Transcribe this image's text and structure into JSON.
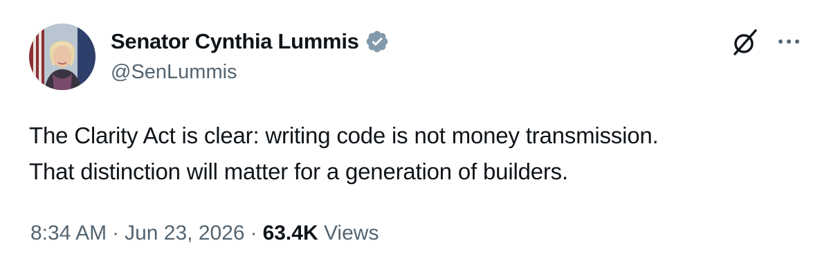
{
  "author": {
    "display_name": "Senator Cynthia Lummis",
    "handle": "@SenLummis",
    "verified_badge": "verified-badge-icon",
    "verified_color": "#829aab"
  },
  "header_actions": {
    "grok": "grok-icon",
    "more": "more-icon"
  },
  "tweet": {
    "lines": [
      "The Clarity Act is clear: writing code is not money transmission.",
      "That distinction will matter for a generation of builders."
    ]
  },
  "meta": {
    "time": "8:34 AM",
    "separator": "·",
    "date": "Jun 23, 2026",
    "views_count": "63.4K",
    "views_label": "Views"
  },
  "colors": {
    "text_primary": "#0f1419",
    "text_secondary": "#536471"
  }
}
